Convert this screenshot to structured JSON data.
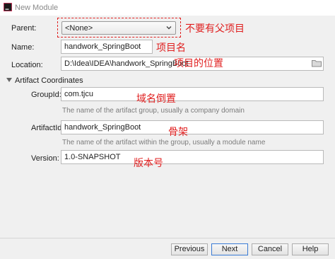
{
  "window": {
    "title": "New Module"
  },
  "parent": {
    "label": "Parent:",
    "value": "<None>",
    "annotation": "不要有父项目"
  },
  "name": {
    "label": "Name:",
    "value": "handwork_SpringBoot",
    "annotation": "项目名"
  },
  "location": {
    "label": "Location:",
    "value": "D:\\Idea\\IDEA\\handwork_SpringBoot",
    "annotation": "项目的位置"
  },
  "artifact": {
    "section_label": "Artifact Coordinates",
    "group_id": {
      "label": "GroupId:",
      "value": "com.tjcu",
      "hint": "The name of the artifact group, usually a company domain",
      "annotation": "域名倒置"
    },
    "artifact_id": {
      "label": "ArtifactId:",
      "value": "handwork_SpringBoot",
      "hint": "The name of the artifact within the group, usually a module name",
      "annotation": "骨架"
    },
    "version": {
      "label": "Version:",
      "value": "1.0-SNAPSHOT",
      "annotation": "版本号"
    }
  },
  "buttons": {
    "previous": "Previous",
    "next": "Next",
    "cancel": "Cancel",
    "help": "Help"
  },
  "icons": {
    "app": "intellij-icon",
    "dropdown": "chevron-down-icon",
    "browse": "folder-icon",
    "collapse": "triangle-down-icon"
  },
  "colors": {
    "annotation": "#e02020",
    "next_border": "#3a7bd5"
  }
}
